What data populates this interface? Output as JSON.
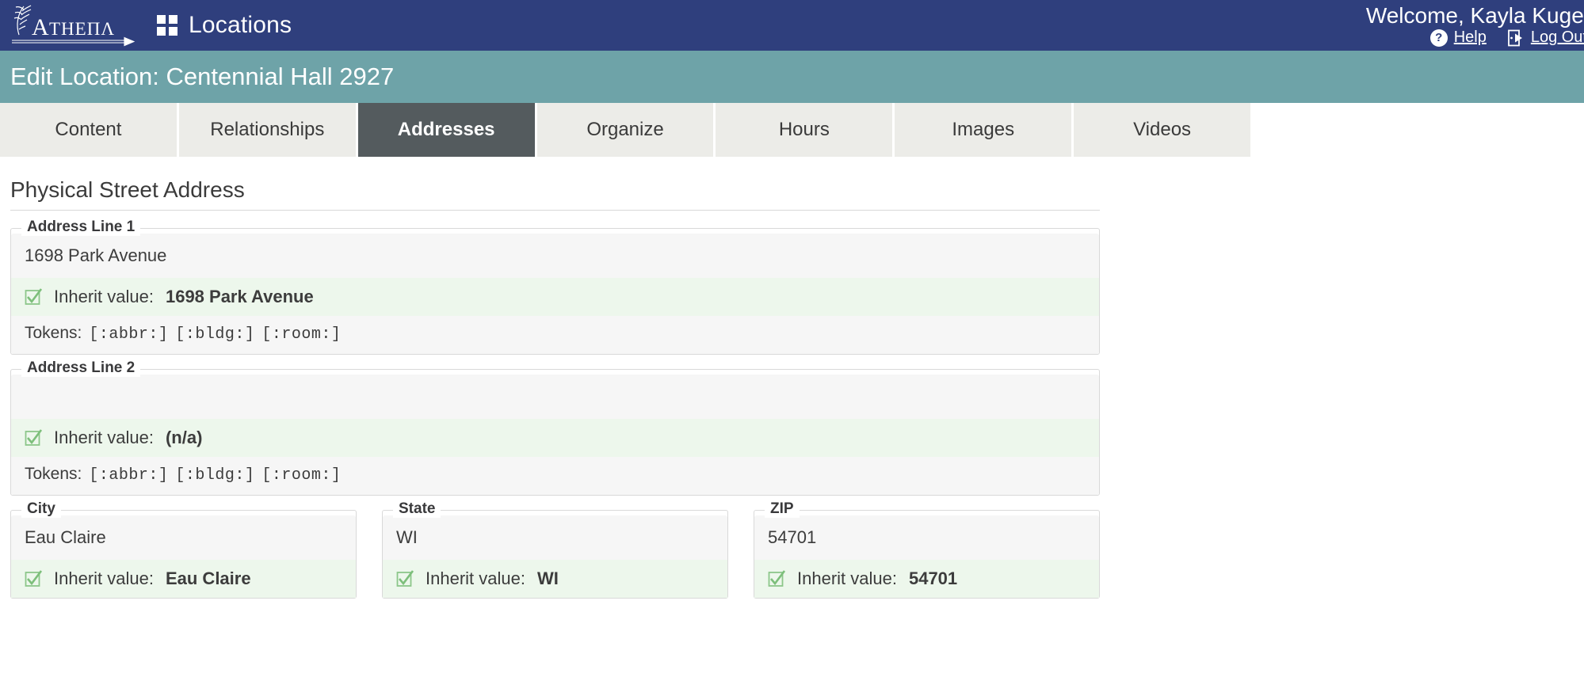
{
  "topbar": {
    "logo_text": "ΑΤΗΕΝΑ",
    "logo_name": "athena-logo",
    "grid_icon": "grid-icon",
    "app_title": "Locations",
    "welcome": "Welcome, Kayla Kugel",
    "help_label": "Help",
    "help_icon": "question-mark-icon",
    "logout_label": "Log Out",
    "logout_icon": "logout-door-icon",
    "bg_color": "#2f3f7d"
  },
  "subbar": {
    "title": "Edit Location: Centennial Hall 2927",
    "bg_color": "#6ea3a8"
  },
  "tabs": [
    {
      "label": "Content",
      "active": false
    },
    {
      "label": "Relationships",
      "active": false
    },
    {
      "label": "Addresses",
      "active": true
    },
    {
      "label": "Organize",
      "active": false
    },
    {
      "label": "Hours",
      "active": false
    },
    {
      "label": "Images",
      "active": false
    },
    {
      "label": "Videos",
      "active": false
    }
  ],
  "content": {
    "section_title": "Physical Street Address",
    "inherit_label": "Inherit value:",
    "tokens_label": "Tokens:",
    "tokens": [
      "[:abbr:]",
      "[:bldg:]",
      "[:room:]"
    ],
    "fields": {
      "address1": {
        "legend": "Address Line 1",
        "value": "1698 Park Avenue",
        "inherit_value": "1698 Park Avenue",
        "inherit_checked": true
      },
      "address2": {
        "legend": "Address Line 2",
        "value": "",
        "inherit_value": "(n/a)",
        "inherit_checked": true
      },
      "city": {
        "legend": "City",
        "value": "Eau Claire",
        "inherit_value": "Eau Claire",
        "inherit_checked": true
      },
      "state": {
        "legend": "State",
        "value": "WI",
        "inherit_value": "WI",
        "inherit_checked": true
      },
      "zip": {
        "legend": "ZIP",
        "value": "54701",
        "inherit_value": "54701",
        "inherit_checked": true
      }
    }
  }
}
